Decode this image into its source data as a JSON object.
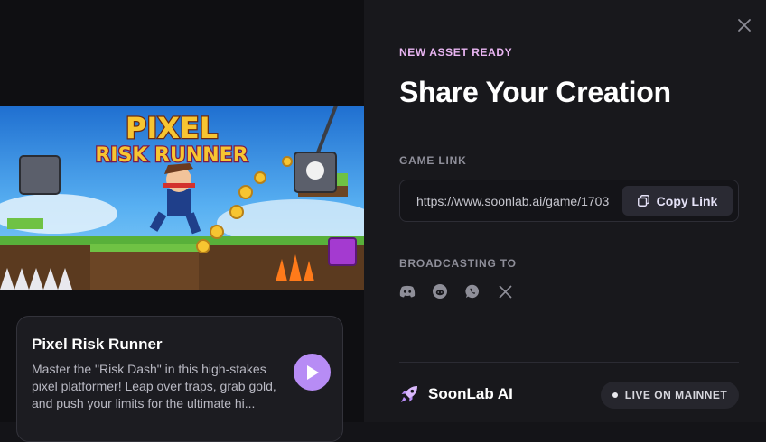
{
  "modal": {
    "eyebrow": "NEW ASSET READY",
    "title": "Share Your Creation",
    "close_icon": "close-icon"
  },
  "game": {
    "logo_line1": "PIXEL",
    "logo_line2": "RISK RUNNER",
    "title": "Pixel Risk Runner",
    "description": "Master the \"Risk Dash\" in this high-stakes pixel platformer! Leap over traps, grab gold, and push your limits for the ultimate hi...",
    "play_icon": "play-icon"
  },
  "link_section": {
    "label": "GAME LINK",
    "url": "https://www.soonlab.ai/game/1703",
    "copy_label": "Copy Link",
    "copy_icon": "copy-icon"
  },
  "broadcast": {
    "label": "BROADCASTING TO",
    "channels": [
      "discord-icon",
      "reddit-icon",
      "whatsapp-icon",
      "x-icon"
    ]
  },
  "footer": {
    "brand": "SoonLab AI",
    "brand_icon": "rocket-icon",
    "status": "LIVE ON MAINNET"
  },
  "colors": {
    "accent": "#b78cf5",
    "eyebrow": "#e9b5f2",
    "background": "#18181c"
  }
}
